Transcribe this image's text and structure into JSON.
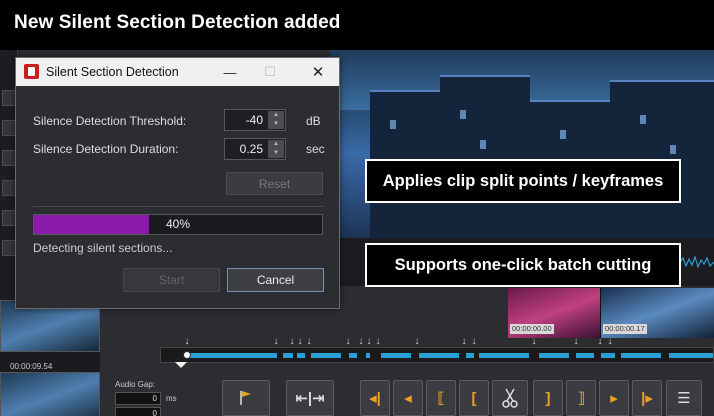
{
  "banner": {
    "title": "New Silent Section Detection added"
  },
  "callouts": {
    "split_points": "Applies clip split points / keyframes",
    "batch_cutting": "Supports one-click batch cutting"
  },
  "dialog": {
    "title": "Silent Section Detection",
    "controls": {
      "minimize": "—",
      "maximize": "☐",
      "close": "✕"
    },
    "threshold": {
      "label": "Silence Detection Threshold:",
      "value": "-40",
      "unit": "dB"
    },
    "duration": {
      "label": "Silence Detection Duration:",
      "value": "0.25",
      "unit": "sec"
    },
    "reset_label": "Reset",
    "progress": {
      "percent": 40,
      "text": "40%"
    },
    "status": "Detecting silent sections...",
    "start_label": "Start",
    "cancel_label": "Cancel"
  },
  "timeline": {
    "clip_times": [
      "00:00:00.00",
      "00:00:00.17"
    ],
    "bin_time": "00:00:09.54",
    "audio_gap": {
      "label": "Audio Gap:",
      "ms_value": "0",
      "ms_unit": "ms",
      "frame_value": "0"
    }
  },
  "icons": {
    "accent": "#f0a020",
    "progress_color": "#8a1aa8",
    "segment_color": "#2a9fd6"
  }
}
